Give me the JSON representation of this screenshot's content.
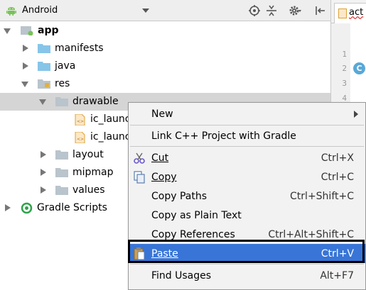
{
  "toolbar": {
    "view_title": "Android",
    "icons": [
      "android-icon",
      "chevron-down-icon",
      "target-icon",
      "collapse-icon",
      "gear-icon",
      "hide-panel-icon"
    ]
  },
  "editor": {
    "tab_label": "act",
    "line_numbers": [
      "1",
      "2",
      "3",
      "4"
    ],
    "class_badge": "C"
  },
  "tree": {
    "items": [
      {
        "label": "app",
        "icon": "module-icon",
        "expanded": true
      },
      {
        "label": "manifests",
        "icon": "folder-icon",
        "expanded": false
      },
      {
        "label": "java",
        "icon": "folder-icon",
        "expanded": false
      },
      {
        "label": "res",
        "icon": "res-folder-icon",
        "expanded": true
      },
      {
        "label": "drawable",
        "icon": "folder-icon",
        "expanded": true,
        "selected": true
      },
      {
        "label": "ic_launch",
        "icon": "xml-file-icon"
      },
      {
        "label": "ic_launch",
        "icon": "xml-file-icon"
      },
      {
        "label": "layout",
        "icon": "folder-icon",
        "expanded": false
      },
      {
        "label": "mipmap",
        "icon": "folder-icon",
        "expanded": false
      },
      {
        "label": "values",
        "icon": "folder-icon",
        "expanded": false
      },
      {
        "label": "Gradle Scripts",
        "icon": "gradle-icon",
        "expanded": false
      }
    ]
  },
  "context_menu": {
    "items": [
      {
        "label": "New",
        "shortcut": "",
        "submenu": true
      },
      {
        "label": "Link C++ Project with Gradle",
        "shortcut": ""
      },
      {
        "label": "Cut",
        "shortcut": "Ctrl+X",
        "icon": "scissors-icon"
      },
      {
        "label": "Copy",
        "shortcut": "Ctrl+C",
        "icon": "copy-icon"
      },
      {
        "label": "Copy Paths",
        "shortcut": "Ctrl+Shift+C"
      },
      {
        "label": "Copy as Plain Text",
        "shortcut": ""
      },
      {
        "label": "Copy References",
        "shortcut": "Ctrl+Alt+Shift+C"
      },
      {
        "label": "Paste",
        "shortcut": "Ctrl+V",
        "icon": "paste-icon",
        "highlighted": true
      },
      {
        "label": "Find Usages",
        "shortcut": "Alt+F7"
      }
    ]
  },
  "colors": {
    "highlight": "#3875d7",
    "folder": "#87c5e8",
    "android_green": "#78c257"
  }
}
